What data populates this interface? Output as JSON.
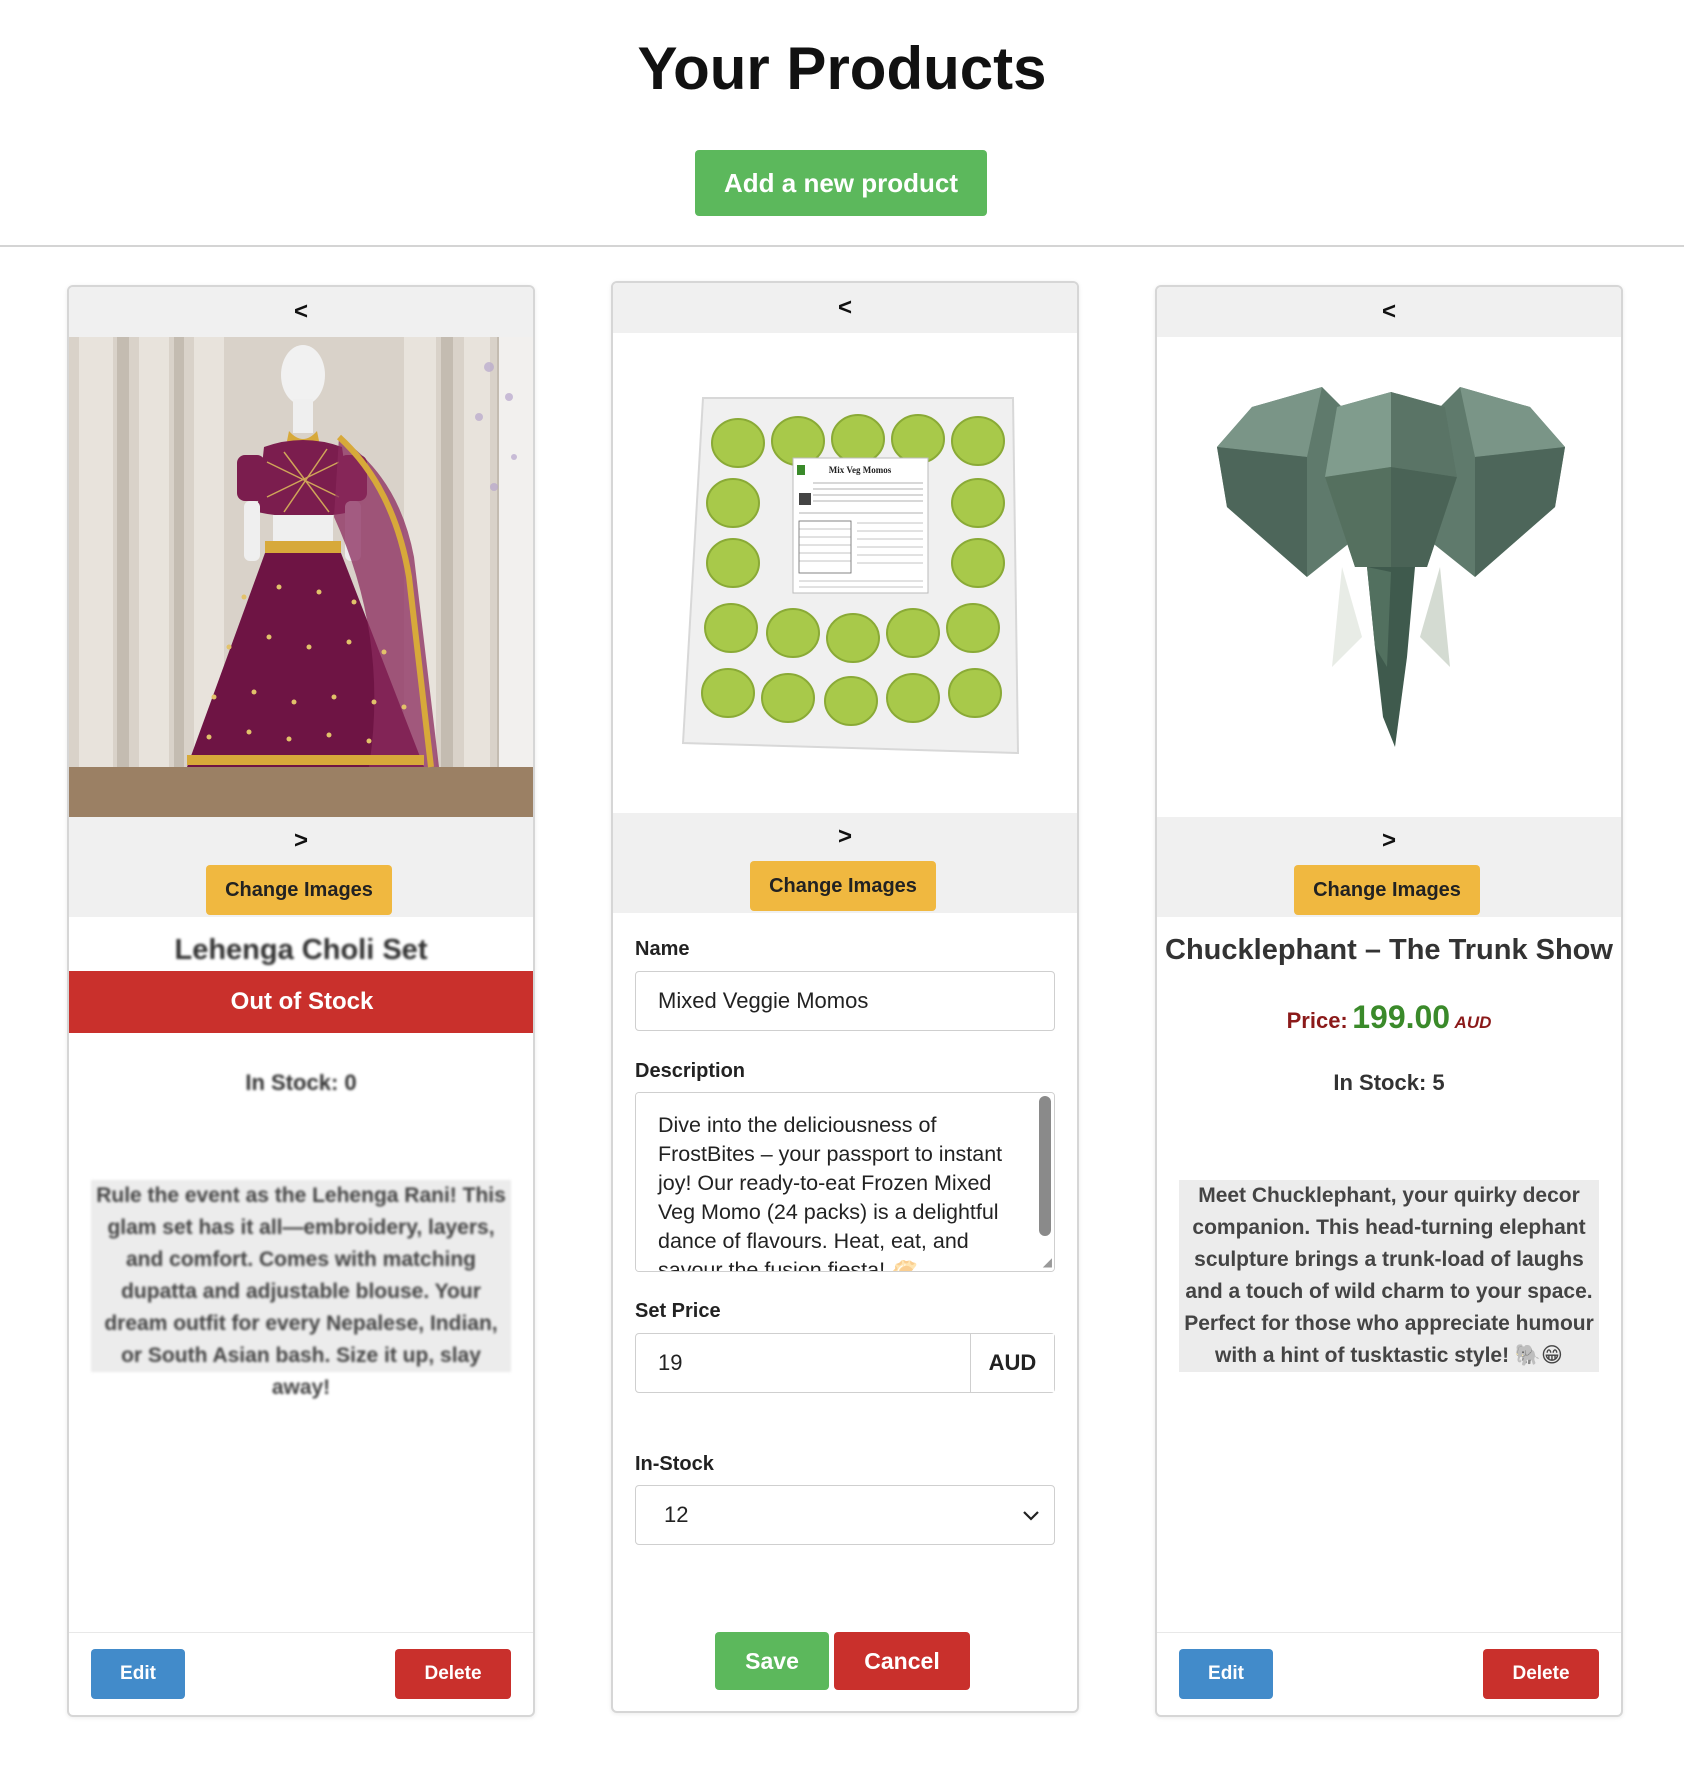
{
  "page": {
    "title": "Your Products",
    "add_button_label": "Add a new product"
  },
  "colors": {
    "primary_green": "#5cb85c",
    "danger_red": "#c9302c",
    "edit_blue": "#428bca",
    "change_images_yellow": "#f0b840",
    "price_green": "#3a8a2a",
    "price_label_red": "#8b1a1a"
  },
  "products": [
    {
      "prev_label": "<",
      "next_label": ">",
      "change_images_label": "Change Images",
      "name": "Lehenga Choli Set",
      "out_of_stock_label": "Out of Stock",
      "stock_text": "In Stock: 0",
      "description": "Rule the event as the Lehenga Rani! This glam set has it all—embroidery, layers, and comfort. Comes with matching dupatta and adjustable blouse. Your dream outfit for every Nepalese, Indian, or South Asian bash. Size it up, slay away!",
      "edit_label": "Edit",
      "delete_label": "Delete"
    },
    {
      "prev_label": "<",
      "next_label": ">",
      "change_images_label": "Change Images",
      "package_label_title": "Mix Veg Momos",
      "name_field_label": "Name",
      "name_value": "Mixed Veggie Momos",
      "description_field_label": "Description",
      "description_value": "Dive into the deliciousness of FrostBites – your passport to instant joy! Our ready-to-eat Frozen Mixed Veg Momo (24 packs) is a delightful dance of flavours. Heat, eat, and savour the fusion fiesta! 🥟",
      "price_field_label": "Set Price",
      "price_value": "19",
      "currency": "AUD",
      "stock_field_label": "In-Stock",
      "stock_value": "12",
      "save_label": "Save",
      "cancel_label": "Cancel"
    },
    {
      "prev_label": "<",
      "next_label": ">",
      "change_images_label": "Change Images",
      "name": "Chucklephant – The Trunk Show",
      "price_label": "Price:",
      "price_value": "199.00",
      "currency": "AUD",
      "stock_text": "In Stock: 5",
      "description": "Meet Chucklephant, your quirky decor companion. This head-turning elephant sculpture brings a trunk-load of laughs and a touch of wild charm to your space. Perfect for those who appreciate humour with a hint of tusktastic style! 🐘😁",
      "edit_label": "Edit",
      "delete_label": "Delete"
    }
  ]
}
